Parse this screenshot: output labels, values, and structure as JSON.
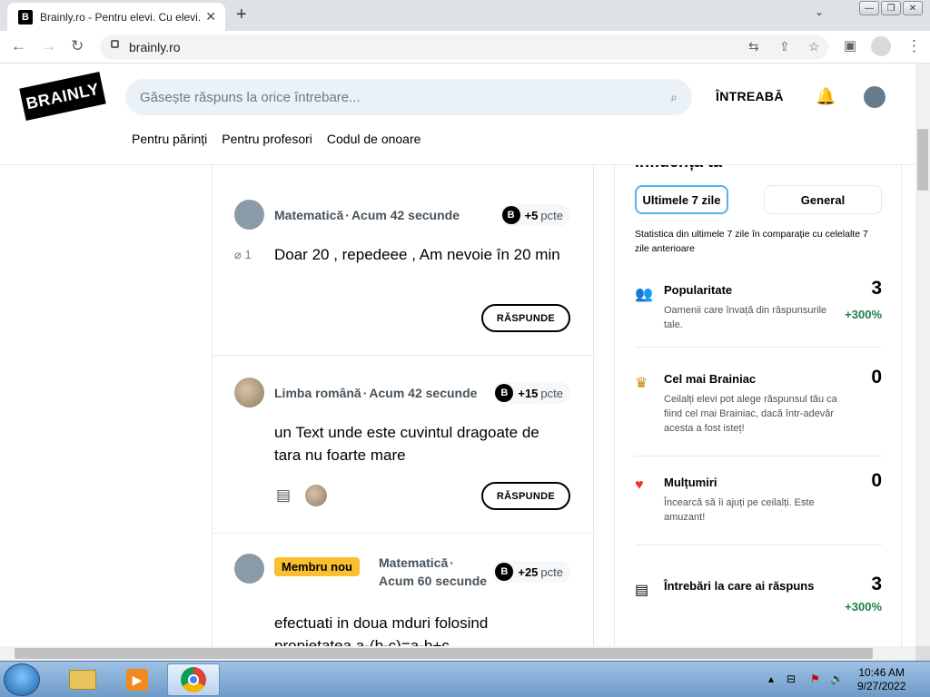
{
  "browser": {
    "tab_title": "Brainly.ro - Pentru elevi. Cu elevi.",
    "tab_close": "✕",
    "new_tab": "+",
    "url": "brainly.ro",
    "window_min": "—",
    "window_max": "❐",
    "window_close": "✕"
  },
  "header": {
    "logo": "BRAINLY",
    "search_placeholder": "Găsește răspuns la orice întrebare...",
    "ask_label": "ÎNTREABĂ",
    "nav": [
      "Pentru părinți",
      "Pentru profesori",
      "Codul de onoare"
    ]
  },
  "feed": {
    "questions": [
      {
        "subject": "Matematică",
        "time": "Acum 42 secunde",
        "points": "+5",
        "points_unit": "pcte",
        "attachments": "1",
        "text": "Doar 20 , repedeee , Am nevoie în 20 min",
        "answer_label": "RĂSPUNDE"
      },
      {
        "subject": "Limba română",
        "time": "Acum 42 secunde",
        "points": "+15",
        "points_unit": "pcte",
        "text": "un Text unde este cuvintul dragoate de tara nu foarte mare",
        "answer_label": "RĂSPUNDE"
      },
      {
        "badge": "Membru nou",
        "subject": "Matematică",
        "time": "Acum 60 secunde",
        "points": "+25",
        "points_unit": "pcte",
        "text": "efectuati in doua mduri folosind propietatea a-(b-c)=a-b+c"
      }
    ]
  },
  "sidebar": {
    "title": "Influența ta",
    "tabs": [
      "Ultimele 7 zile",
      "General"
    ],
    "description": "Statistica din ultimele 7 zile în comparație cu celelalte 7 zile anterioare",
    "stats": [
      {
        "name": "Popularitate",
        "value": "3",
        "desc": "Oamenii care învață din răspunsurile tale.",
        "pct": "+300%"
      },
      {
        "name": "Cel mai Brainiac",
        "value": "0",
        "desc": "Ceilalți elevi pot alege răspunsul tău ca fiind cel mai Brainiac, dacă într-adevăr acesta a fost isteț!"
      },
      {
        "name": "Mulțumiri",
        "value": "0",
        "desc": "Încearcă să îi ajuți pe ceilalți. Este amuzant!"
      },
      {
        "name": "Întrebări la care ai răspuns",
        "value": "3",
        "pct": "+300%"
      }
    ]
  },
  "taskbar": {
    "time": "10:46 AM",
    "date": "9/27/2022"
  }
}
